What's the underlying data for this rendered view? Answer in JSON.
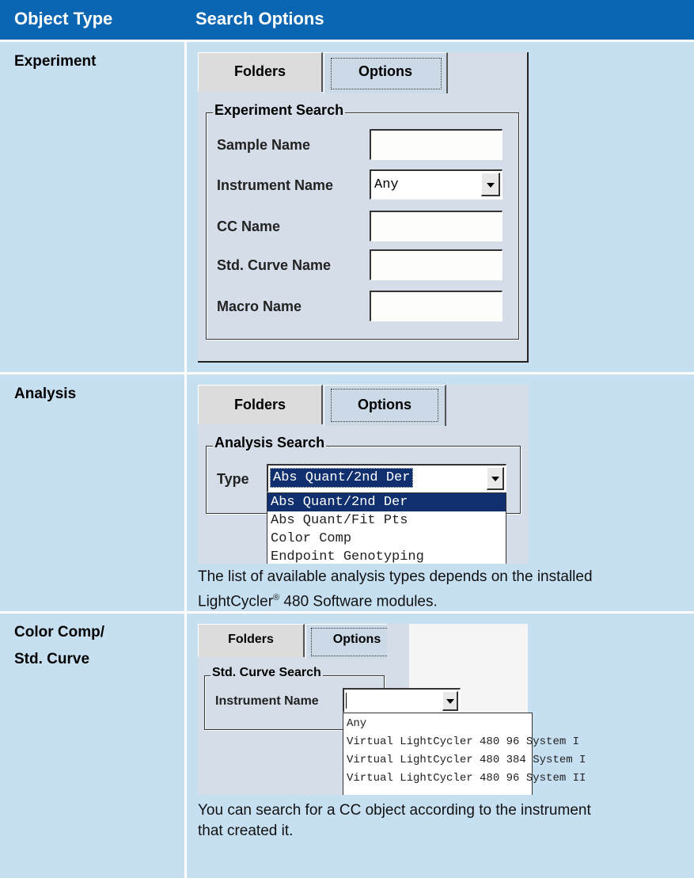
{
  "header": {
    "col1": "Object Type",
    "col2": "Search Options"
  },
  "experiment": {
    "label": "Experiment",
    "tabs": {
      "folders": "Folders",
      "options": "Options"
    },
    "group_title": "Experiment Search",
    "fields": {
      "sample_name": "Sample Name",
      "instrument_name": "Instrument Name",
      "instrument_value": "Any",
      "cc_name": "CC Name",
      "std_curve_name": "Std. Curve Name",
      "macro_name": "Macro Name"
    }
  },
  "analysis": {
    "label": "Analysis",
    "tabs": {
      "folders": "Folders",
      "options": "Options"
    },
    "group_title": "Analysis Search",
    "type_label": "Type",
    "type_value": "Abs Quant/2nd Der",
    "options": [
      "Abs Quant/2nd Der",
      "Abs Quant/Fit Pts",
      "Color Comp",
      "Endpoint Genotyping"
    ],
    "note_line1": "The list of available analysis types depends on the installed",
    "note_line2": "LightCycler",
    "note_reg": "®",
    "note_line2_rest": " 480 Software modules."
  },
  "colorcomp": {
    "label_line1": "Color Comp/",
    "label_line2": "Std. Curve",
    "tabs": {
      "folders": "Folders",
      "options": "Options"
    },
    "group_title": "Std. Curve Search",
    "instrument_label": "Instrument Name",
    "instrument_value": "",
    "options": [
      "Any",
      "Virtual LightCycler 480 96 System I",
      "Virtual LightCycler 480 384 System I",
      "Virtual LightCycler 480 96 System II"
    ],
    "note_line1": "You can search for a CC object according to the instrument",
    "note_line2": "that created it."
  },
  "colors": {
    "header_bg": "#0a66b2",
    "row_bg": "#c7e0f1",
    "selection": "#0f2f6e"
  }
}
